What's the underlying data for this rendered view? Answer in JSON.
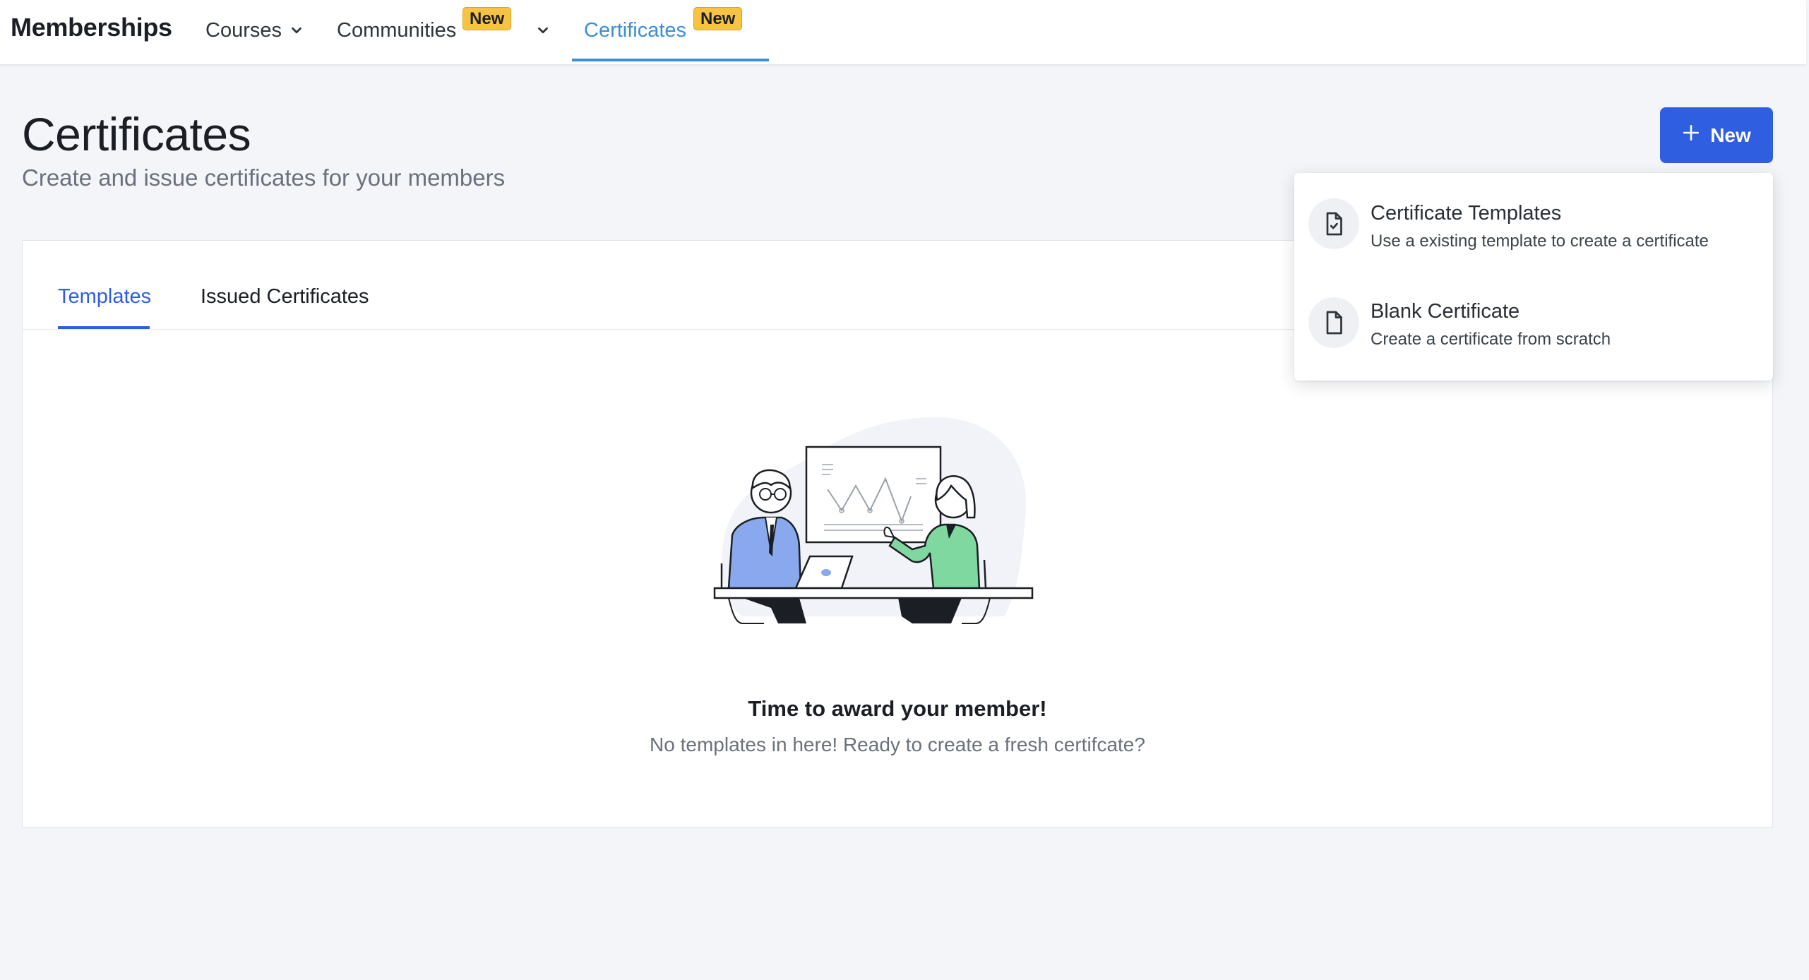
{
  "app": {
    "title": "Memberships"
  },
  "nav": {
    "items": [
      {
        "label": "Courses",
        "has_dropdown": true
      },
      {
        "label": "Communities",
        "badge": "New",
        "has_dropdown": true
      },
      {
        "label": "Certificates",
        "badge": "New",
        "active": true
      }
    ]
  },
  "page": {
    "title": "Certificates",
    "subtitle": "Create and issue certificates for your members",
    "new_button_label": "New"
  },
  "tabs": [
    {
      "label": "Templates",
      "active": true
    },
    {
      "label": "Issued Certificates",
      "active": false
    }
  ],
  "empty_state": {
    "title": "Time to award your member!",
    "description": "No templates in here! Ready to create a fresh certifcate?"
  },
  "dropdown": {
    "items": [
      {
        "title": "Certificate Templates",
        "description": "Use a existing template to create a certificate",
        "icon": "file-check-icon"
      },
      {
        "title": "Blank Certificate",
        "description": "Create a certificate from scratch",
        "icon": "file-icon"
      }
    ]
  },
  "colors": {
    "accent_blue": "#2f5ee0",
    "nav_active": "#3b8ed6",
    "badge_yellow": "#f6c343",
    "page_background": "#f3f5f8"
  }
}
